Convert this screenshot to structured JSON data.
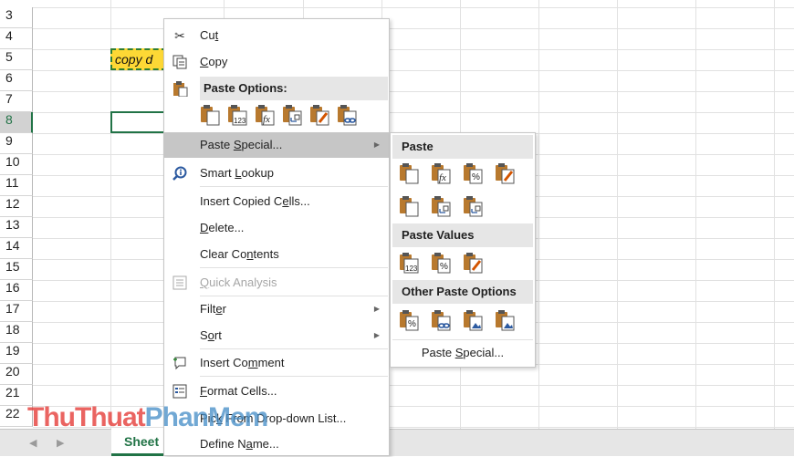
{
  "rows": [
    "3",
    "4",
    "5",
    "6",
    "7",
    "8",
    "9",
    "10",
    "11",
    "12",
    "13",
    "14",
    "15",
    "16",
    "17",
    "18",
    "19",
    "20",
    "21",
    "22"
  ],
  "selected_row": "8",
  "cells": {
    "copied_text": "copy d"
  },
  "sheet_tab": "Sheet",
  "context_menu": {
    "cut": "Cut",
    "copy": "Copy",
    "paste_options_header": "Paste Options:",
    "paste_special": "Paste Special...",
    "smart_lookup": "Smart Lookup",
    "insert_copied_cells": "Insert Copied Cells...",
    "delete": "Delete...",
    "clear_contents": "Clear Contents",
    "quick_analysis": "Quick Analysis",
    "filter": "Filter",
    "sort": "Sort",
    "insert_comment": "Insert Comment",
    "format_cells": "Format Cells...",
    "pick_list": "Pick From Drop-down List...",
    "define_name": "Define Name...",
    "paste_icons": [
      "paste-icon",
      "paste-values-icon",
      "paste-formulas-icon",
      "paste-transpose-icon",
      "paste-formatting-icon",
      "paste-link-icon"
    ]
  },
  "submenu": {
    "paste_header": "Paste",
    "paste_values_header": "Paste Values",
    "other_header": "Other Paste Options",
    "paste_special": "Paste Special..."
  },
  "icon_glyphs": {
    "values": "123",
    "formula": "fx",
    "percent": "%"
  },
  "watermark": {
    "part1": "ThuThuat",
    "part2": "PhanMem",
    ".vn": ".vn"
  },
  "colors": {
    "accent": "#217346",
    "copy_fill": "#fdd835",
    "menu_highlight": "#c6c6c6",
    "clipboard": "#b8792e",
    "doc": "#ffffff"
  }
}
